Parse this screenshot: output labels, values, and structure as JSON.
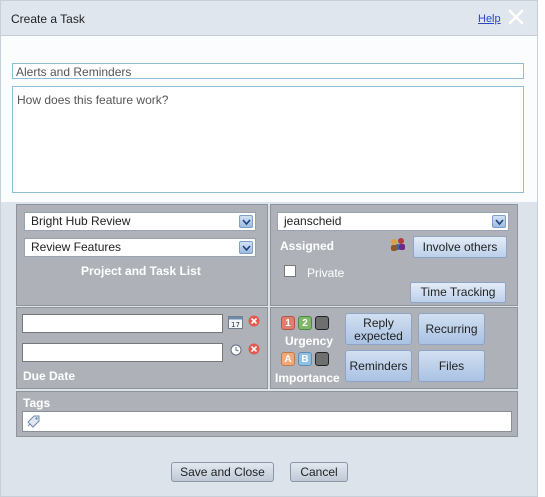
{
  "window": {
    "title": "Create a Task",
    "help_link": "Help",
    "close_icon": "close-icon"
  },
  "task": {
    "title_value": "Alerts and Reminders",
    "description_value": "How does this feature work?"
  },
  "project_panel": {
    "project_select": "Bright Hub Review",
    "task_list_select": "Review Features",
    "label": "Project and Task List"
  },
  "assign_panel": {
    "assignee_select": "jeanscheid",
    "assigned_label": "Assigned",
    "involve_button": "Involve others",
    "private_label": "Private",
    "private_checked": false,
    "time_tracking_button": "Time Tracking"
  },
  "due_panel": {
    "label": "Due Date",
    "date_value": "",
    "time_value": ""
  },
  "priority_panel": {
    "urgency_label": "Urgency",
    "urgency_levels": [
      "1",
      "2",
      ""
    ],
    "importance_label": "Importance",
    "importance_levels": [
      "A",
      "B",
      ""
    ],
    "reply_button": "Reply expected",
    "recurring_button": "Recurring",
    "reminders_button": "Reminders",
    "files_button": "Files"
  },
  "tags_panel": {
    "label": "Tags",
    "value": ""
  },
  "footer": {
    "save_label": "Save and Close",
    "cancel_label": "Cancel"
  },
  "colors": {
    "urgency_1": "#e07d6e",
    "urgency_2": "#7fb86a",
    "importance_a": "#f0a97a",
    "importance_b": "#8fbfe2",
    "panel_gray": "#aeb2b8",
    "link": "#2b44c8"
  }
}
